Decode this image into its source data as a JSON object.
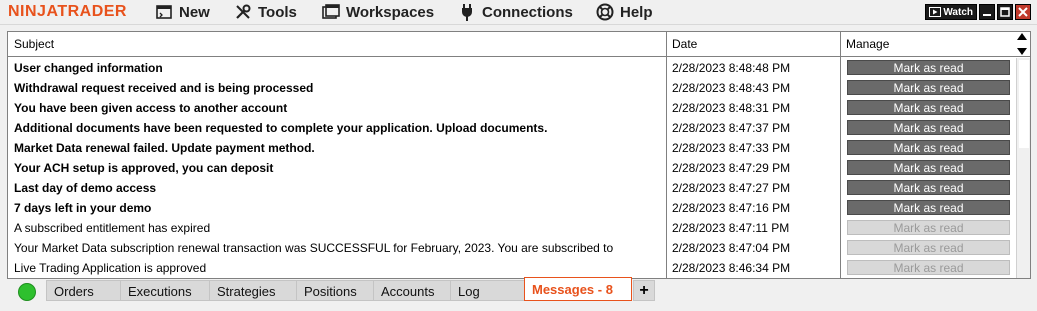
{
  "app": {
    "logo_text": "NINJATRADER",
    "brand_color": "#e8521c"
  },
  "menu": [
    {
      "name": "menu-new",
      "label": "New",
      "icon": "new-window-icon"
    },
    {
      "name": "menu-tools",
      "label": "Tools",
      "icon": "tools-icon"
    },
    {
      "name": "menu-workspaces",
      "label": "Workspaces",
      "icon": "workspaces-icon"
    },
    {
      "name": "menu-connections",
      "label": "Connections",
      "icon": "plug-icon"
    },
    {
      "name": "menu-help",
      "label": "Help",
      "icon": "lifebuoy-icon"
    }
  ],
  "window_controls": {
    "watch_label": "Watch"
  },
  "grid": {
    "columns": {
      "subject": "Subject",
      "date": "Date",
      "manage": "Manage"
    },
    "rows": [
      {
        "subject": "User changed information",
        "date": "2/28/2023 8:48:48 PM",
        "action": "Mark as read",
        "unread": true
      },
      {
        "subject": "Withdrawal request received and is being processed",
        "date": "2/28/2023 8:48:43 PM",
        "action": "Mark as read",
        "unread": true
      },
      {
        "subject": "You have been given access to another account",
        "date": "2/28/2023 8:48:31 PM",
        "action": "Mark as read",
        "unread": true
      },
      {
        "subject": "Additional documents have been requested to complete your application. Upload documents.",
        "date": "2/28/2023 8:47:37 PM",
        "action": "Mark as read",
        "unread": true
      },
      {
        "subject": "Market Data renewal failed. Update payment method.",
        "date": "2/28/2023 8:47:33 PM",
        "action": "Mark as read",
        "unread": true
      },
      {
        "subject": "Your ACH setup is approved, you can deposit",
        "date": "2/28/2023 8:47:29 PM",
        "action": "Mark as read",
        "unread": true
      },
      {
        "subject": "Last day of demo access",
        "date": "2/28/2023 8:47:27 PM",
        "action": "Mark as read",
        "unread": true
      },
      {
        "subject": "7 days left in your demo",
        "date": "2/28/2023 8:47:16 PM",
        "action": "Mark as read",
        "unread": true
      },
      {
        "subject": "A subscribed entitlement has expired",
        "date": "2/28/2023 8:47:11 PM",
        "action": "Mark as read",
        "unread": false
      },
      {
        "subject": "Your Market Data subscription renewal transaction was SUCCESSFUL for February, 2023. You are subscribed to",
        "date": "2/28/2023 8:47:04 PM",
        "action": "Mark as read",
        "unread": false
      },
      {
        "subject": "Live Trading Application is approved",
        "date": "2/28/2023 8:46:34 PM",
        "action": "Mark as read",
        "unread": false
      }
    ]
  },
  "tabs": [
    {
      "name": "tab-orders",
      "label": "Orders",
      "active": false
    },
    {
      "name": "tab-executions",
      "label": "Executions",
      "active": false
    },
    {
      "name": "tab-strategies",
      "label": "Strategies",
      "active": false
    },
    {
      "name": "tab-positions",
      "label": "Positions",
      "active": false
    },
    {
      "name": "tab-accounts",
      "label": "Accounts",
      "active": false
    },
    {
      "name": "tab-log",
      "label": "Log",
      "active": false
    },
    {
      "name": "tab-messages",
      "label": "Messages - 8",
      "active": true
    }
  ],
  "add_tab_label": "+",
  "connection_status_color": "#2ec02e"
}
